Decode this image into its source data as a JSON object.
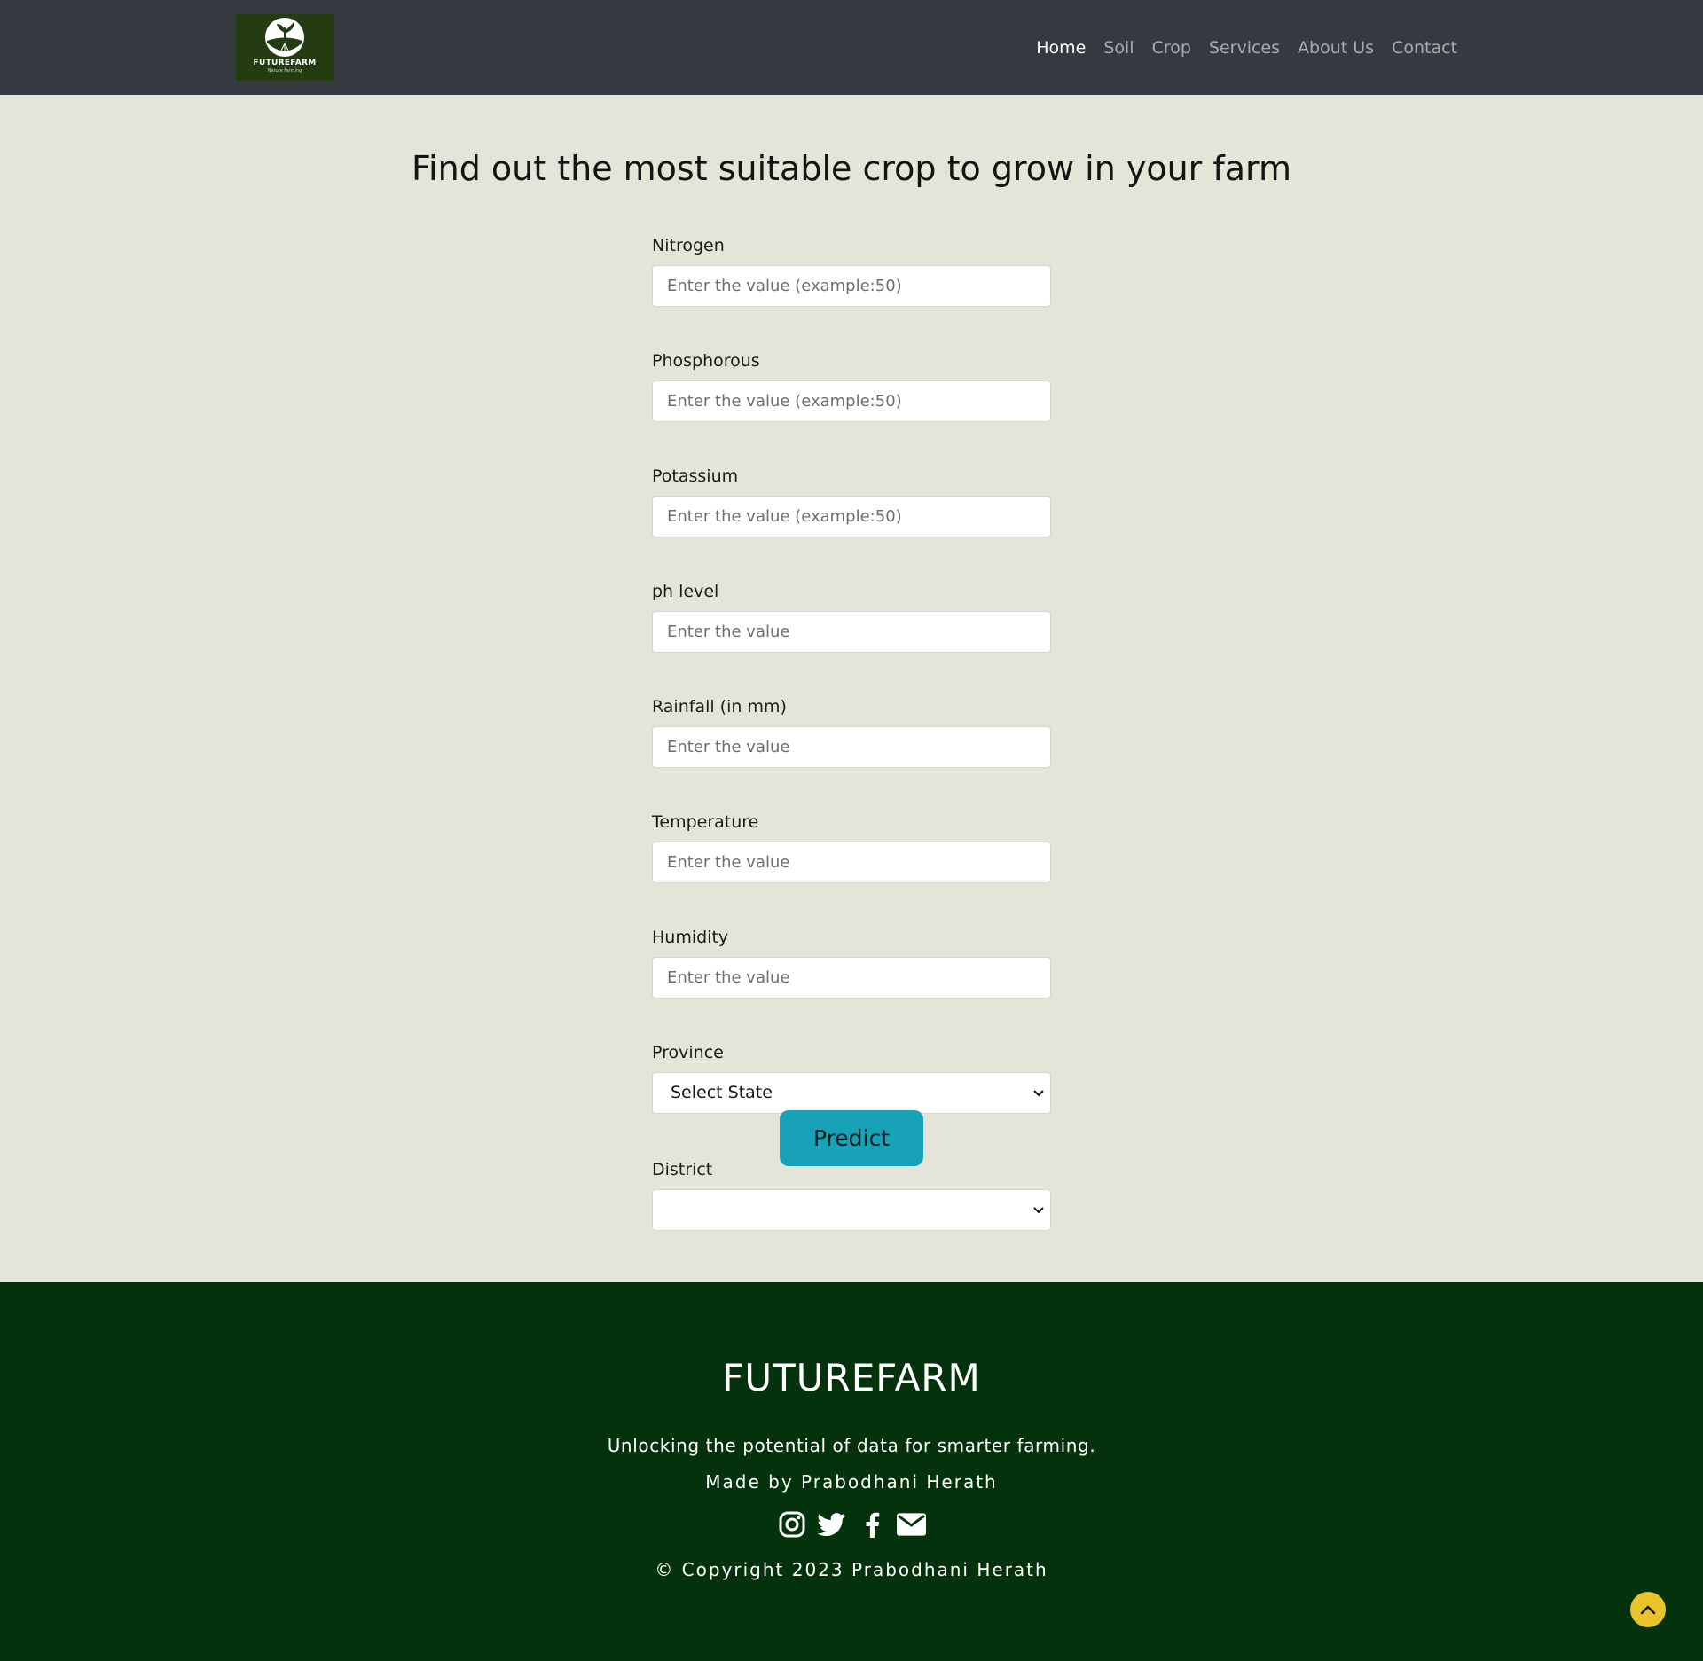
{
  "brand": {
    "logo_name": "FUTUREFARM",
    "logo_tagline": "Nature Farming",
    "logo_bg": "#253c12"
  },
  "nav": {
    "items": [
      {
        "label": "Home",
        "active": true
      },
      {
        "label": "Soil",
        "active": false
      },
      {
        "label": "Crop",
        "active": false
      },
      {
        "label": "Services",
        "active": false
      },
      {
        "label": "About Us",
        "active": false
      },
      {
        "label": "Contact",
        "active": false
      }
    ]
  },
  "main": {
    "title": "Find out the most suitable crop to grow in your farm",
    "fields": [
      {
        "label": "Nitrogen",
        "placeholder": "Enter the value (example:50)",
        "value": ""
      },
      {
        "label": "Phosphorous",
        "placeholder": "Enter the value (example:50)",
        "value": ""
      },
      {
        "label": "Potassium",
        "placeholder": "Enter the value (example:50)",
        "value": ""
      },
      {
        "label": "ph level",
        "placeholder": "Enter the value",
        "value": ""
      },
      {
        "label": "Rainfall (in mm)",
        "placeholder": "Enter the value",
        "value": ""
      },
      {
        "label": "Temperature",
        "placeholder": "Enter the value",
        "value": ""
      },
      {
        "label": "Humidity",
        "placeholder": "Enter the value",
        "value": ""
      }
    ],
    "province": {
      "label": "Province",
      "selected": "Select State"
    },
    "district": {
      "label": "District",
      "selected": ""
    },
    "predict_label": "Predict"
  },
  "footer": {
    "brand": "FUTUREFARM",
    "tagline": "Unlocking the potential of data for smarter farming.",
    "made_by": "Made by Prabodhani Herath",
    "socials": [
      "instagram-icon",
      "twitter-icon",
      "facebook-icon",
      "mail-icon"
    ],
    "copyright": "© Copyright 2023 Prabodhani Herath"
  },
  "colors": {
    "navbar": "#343a40",
    "page_bg": "#e4e4d9",
    "accent": "#17a2b8",
    "footer_bg": "#04320d",
    "back_to_top": "#e8c32b"
  }
}
